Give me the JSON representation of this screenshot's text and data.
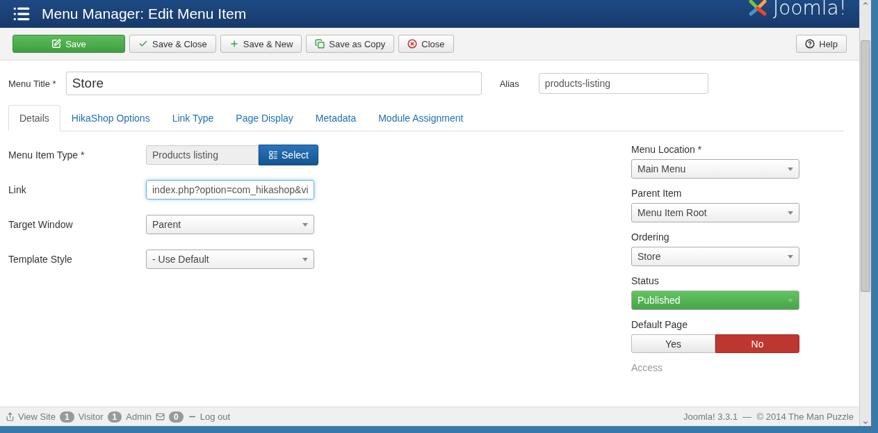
{
  "header": {
    "title": "Menu Manager: Edit Menu Item",
    "logo_text": "Joomla!"
  },
  "toolbar": {
    "buttons": [
      {
        "label": "Save",
        "kind": "primary"
      },
      {
        "label": "Save & Close",
        "kind": "default"
      },
      {
        "label": "Save & New",
        "kind": "default"
      },
      {
        "label": "Save as Copy",
        "kind": "default"
      },
      {
        "label": "Close",
        "kind": "default"
      }
    ],
    "help": {
      "label": "Help"
    }
  },
  "title_row": {
    "menu_title": {
      "label": "Menu Title *",
      "value": "Store"
    },
    "alias": {
      "label": "Alias",
      "value": "products-listing"
    }
  },
  "tabs": [
    {
      "label": "Details",
      "selected": true
    },
    {
      "label": "HikaShop Options",
      "selected": false
    },
    {
      "label": "Link Type",
      "selected": false
    },
    {
      "label": "Page Display",
      "selected": false
    },
    {
      "label": "Metadata",
      "selected": false
    },
    {
      "label": "Module Assignment",
      "selected": false
    }
  ],
  "left_fields": [
    {
      "kind": "type",
      "label": "Menu Item Type *",
      "value": "Products listing",
      "button": "Select"
    },
    {
      "kind": "input",
      "label": "Link",
      "value": "index.php?option=com_hikashop&vi",
      "focused": true
    },
    {
      "kind": "select",
      "label": "Target Window",
      "value": "Parent"
    },
    {
      "kind": "select",
      "label": "Template Style",
      "value": "- Use Default"
    }
  ],
  "right_fields": [
    {
      "kind": "select",
      "label": "Menu Location *",
      "value": "Main Menu"
    },
    {
      "kind": "select",
      "label": "Parent Item",
      "value": "Menu Item Root"
    },
    {
      "kind": "select",
      "label": "Ordering",
      "value": "Store"
    },
    {
      "kind": "status",
      "label": "Status",
      "value": "Published"
    },
    {
      "kind": "toggle",
      "label": "Default Page",
      "options": [
        {
          "label": "Yes",
          "selected": false
        },
        {
          "label": "No",
          "selected": true
        }
      ]
    },
    {
      "kind": "cut",
      "label": "Access"
    }
  ],
  "status_bar": {
    "view_site": "View Site",
    "visitors": "1",
    "visitor_label": "Visitor",
    "admins": "1",
    "admin_label": "Admin",
    "messages": "0",
    "logout": "Log out",
    "copyright": "Joomla! 3.3.1  —  © 2014 The Man Puzzle"
  }
}
